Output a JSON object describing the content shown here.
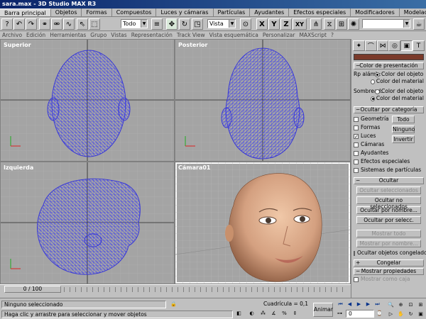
{
  "window": {
    "title": "sara.max - 3D Studio MAX R3"
  },
  "tabs": [
    {
      "label": "Barra principal",
      "active": true
    },
    {
      "label": "Objetos"
    },
    {
      "label": "Formas"
    },
    {
      "label": "Compuestos"
    },
    {
      "label": "Luces y cámaras"
    },
    {
      "label": "Partículas"
    },
    {
      "label": "Ayudantes"
    },
    {
      "label": "Efectos especiales"
    },
    {
      "label": "Modificadores"
    },
    {
      "label": "Modelado"
    },
    {
      "label": "Represe"
    }
  ],
  "toolbar": {
    "selection_filter": "Todo",
    "reference_coord": "Vista",
    "axis_labels": {
      "x": "X",
      "y": "Y",
      "z": "Z",
      "xy": "XY"
    },
    "named_selection": ""
  },
  "menu": [
    "Archivo",
    "Edición",
    "Herramientas",
    "Grupo",
    "Vistas",
    "Representación",
    "Track View",
    "Vista esquemática",
    "Personalizar",
    "MAXScript",
    "?"
  ],
  "viewports": [
    {
      "name": "Superior"
    },
    {
      "name": "Posterior"
    },
    {
      "name": "Izquierda"
    },
    {
      "name": "Cámara01"
    }
  ],
  "panel": {
    "color_presentacion": {
      "title": "Color de presentación",
      "rp_label": "Rp alámb:",
      "shaded_label": "Sombread:",
      "opt_object": "Color del objeto",
      "opt_material": "Color del material",
      "rp_selected": "object",
      "shaded_selected": "material"
    },
    "ocultar_categoria": {
      "title": "Ocultar por categoría",
      "items": [
        {
          "label": "Geometría",
          "checked": false
        },
        {
          "label": "Formas",
          "checked": false
        },
        {
          "label": "Luces",
          "checked": true
        },
        {
          "label": "Cámaras",
          "checked": false
        },
        {
          "label": "Ayudantes",
          "checked": false
        },
        {
          "label": "Efectos especiales",
          "checked": false
        },
        {
          "label": "Sistemas de partículas",
          "checked": false
        }
      ],
      "btn_all": "Todo",
      "btn_none": "Ninguno",
      "btn_invert": "Invertir"
    },
    "ocultar": {
      "title": "Ocultar",
      "buttons": [
        {
          "label": "Ocultar seleccionados",
          "disabled": true
        },
        {
          "label": "Ocultar no seleccionados",
          "disabled": false
        },
        {
          "label": "Ocultar por nombre...",
          "disabled": false
        },
        {
          "label": "Ocultar por selecc.",
          "disabled": false
        },
        {
          "label": "Mostrar todo",
          "disabled": true
        },
        {
          "label": "Mostrar por nombre...",
          "disabled": true
        }
      ],
      "frozen_label": "Ocultar objetos congelados",
      "frozen_checked": false
    },
    "congelar": {
      "title": "Congelar"
    },
    "mostrar_propiedades": {
      "title": "Mostrar propiedades",
      "box_label": "Mostrar como caja"
    }
  },
  "timeline": {
    "slider": "0 / 100"
  },
  "status": {
    "selection": "Ninguno seleccionado",
    "prompt": "Haga clic y arrastre para seleccionar y mover objetos",
    "grid": "Cuadrícula = 0,1",
    "animate": "Animar",
    "frame": "0"
  },
  "colors": {
    "wire": "#4a4ae6",
    "viewport_bg": "#a4a4a4",
    "skin": "#d9a888"
  }
}
